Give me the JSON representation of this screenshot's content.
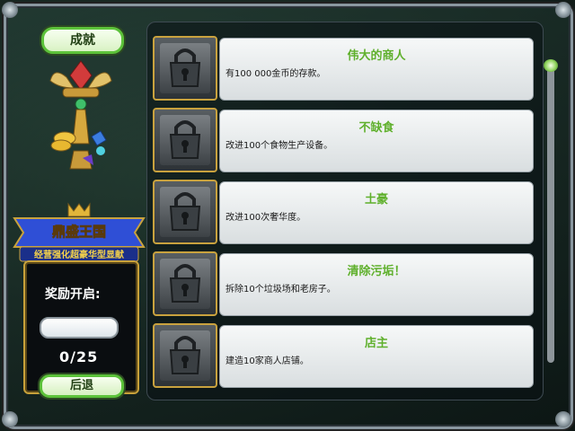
{
  "title_pill": {
    "label": "成就"
  },
  "left_panel": {
    "logo_line1": "鼎盛王国",
    "logo_line2": "经营强化超豪华型显献",
    "reward_label": "奖励开启:",
    "reward_input_value": "",
    "progress_text": "0/25",
    "back_label": "后退"
  },
  "achievements": [
    {
      "name": "伟大的商人",
      "desc": "有100 000金币的存款。",
      "icon": "lock-icon"
    },
    {
      "name": "不缺食",
      "desc": "改进100个食物生产设备。",
      "icon": "lock-icon"
    },
    {
      "name": "土豪",
      "desc": "改进100次奢华度。",
      "icon": "lock-icon"
    },
    {
      "name": "清除污垢！",
      "desc": "拆除10个垃圾场和老房子。",
      "icon": "lock-icon"
    },
    {
      "name": "店主",
      "desc": "建造10家商人店铺。",
      "icon": "lock-icon"
    }
  ],
  "colors": {
    "accent_green": "#5fb02c",
    "gold_border": "#c9a23e",
    "pill_green": "#5cc23a"
  }
}
